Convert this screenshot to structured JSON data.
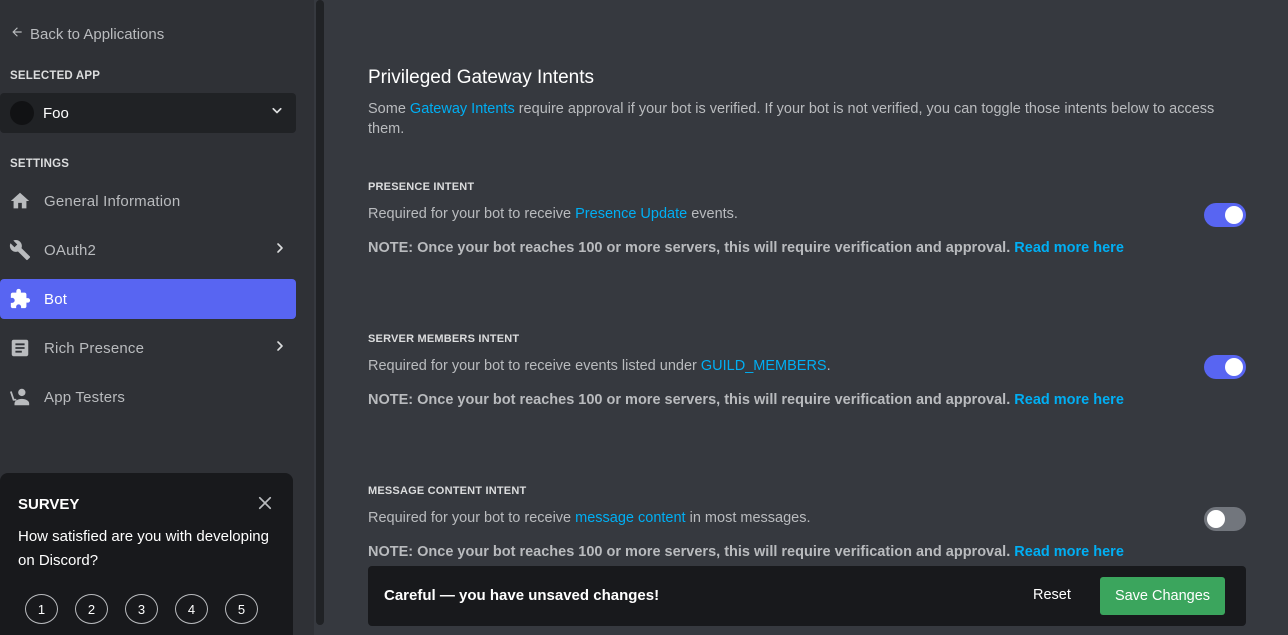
{
  "sidebar": {
    "back_label": "Back to Applications",
    "selected_app_heading": "SELECTED APP",
    "app_name": "Foo",
    "settings_heading": "SETTINGS",
    "items": [
      {
        "label": "General Information",
        "icon": "home-icon"
      },
      {
        "label": "OAuth2",
        "icon": "wrench-icon"
      },
      {
        "label": "Bot",
        "icon": "puzzle-icon"
      },
      {
        "label": "Rich Presence",
        "icon": "document-icon"
      },
      {
        "label": "App Testers",
        "icon": "user-icon"
      }
    ]
  },
  "survey": {
    "title": "SURVEY",
    "question": "How satisfied are you with developing on Discord?",
    "ratings": [
      "1",
      "2",
      "3",
      "4",
      "5"
    ]
  },
  "main": {
    "heading": "Privileged Gateway Intents",
    "desc_prefix": "Some ",
    "desc_link": "Gateway Intents",
    "desc_suffix": " require approval if your bot is verified. If your bot is not verified, you can toggle those intents below to access them.",
    "intents": [
      {
        "label": "PRESENCE INTENT",
        "desc_prefix": "Required for your bot to receive ",
        "desc_link": "Presence Update",
        "desc_suffix": " events.",
        "note": "NOTE: Once your bot reaches 100 or more servers, this will require verification and approval.",
        "note_link": "Read more here",
        "enabled": true
      },
      {
        "label": "SERVER MEMBERS INTENT",
        "desc_prefix": "Required for your bot to receive events listed under ",
        "desc_link": "GUILD_MEMBERS",
        "desc_suffix": ".",
        "note": "NOTE: Once your bot reaches 100 or more servers, this will require verification and approval.",
        "note_link": "Read more here",
        "enabled": true
      },
      {
        "label": "MESSAGE CONTENT INTENT",
        "desc_prefix": "Required for your bot to receive ",
        "desc_link": "message content",
        "desc_suffix": " in most messages.",
        "note": "NOTE: Once your bot reaches 100 or more servers, this will require verification and approval.",
        "note_link": "Read more here",
        "enabled": false
      }
    ]
  },
  "unsaved": {
    "message": "Careful — you have unsaved changes!",
    "reset_label": "Reset",
    "save_label": "Save Changes"
  },
  "colors": {
    "accent": "#5865f2",
    "link": "#00aff4",
    "save": "#3ba55d",
    "background": "#36393f",
    "sidebar": "#2f3136"
  }
}
